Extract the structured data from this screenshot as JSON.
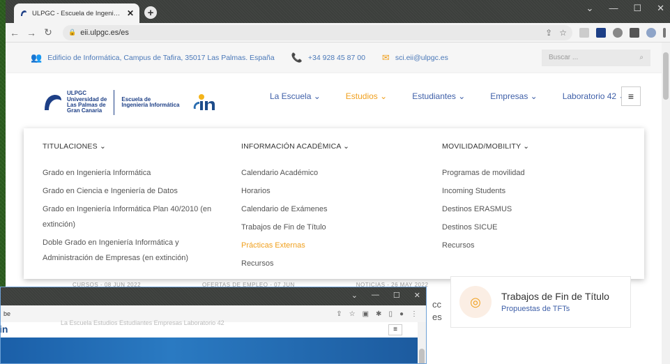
{
  "browser": {
    "tab_title": "ULPGC - Escuela de Ingeniería Inf...",
    "tab_close": "✕",
    "new_tab": "+",
    "url": "eii.ulpgc.es/es",
    "window_controls": [
      "⌄",
      "—",
      "☐",
      "✕"
    ]
  },
  "topinfo": {
    "address": "Edificio de Informática, Campus de Tafira, 35017 Las Palmas. España",
    "phone": "+34 928 45 87 00",
    "email": "sci.eii@ulpgc.es",
    "search_placeholder": "Buscar ..."
  },
  "logo": {
    "ulpgc_line1": "ULPGC",
    "ulpgc_line2": "Universidad de",
    "ulpgc_line3": "Las Palmas de",
    "ulpgc_line4": "Gran Canaria",
    "eii_line1": "Escuela de",
    "eii_line2": "Ingeniería Informática"
  },
  "nav": {
    "items": [
      {
        "label": "La Escuela ⌄"
      },
      {
        "label": "Estudios ⌄"
      },
      {
        "label": "Estudiantes ⌄"
      },
      {
        "label": "Empresas ⌄"
      },
      {
        "label": "Laboratorio 42 ⌄"
      }
    ],
    "menu_icon": "≡"
  },
  "megamenu": {
    "titulaciones": {
      "heading": "TITULACIONES ⌄",
      "links": [
        "Grado en Ingeniería Informática",
        "Grado en Ciencia e Ingeniería de Datos",
        "Grado en Ingeniería Informática Plan 40/2010 (en",
        "extinción)",
        "Doble Grado en Ingeniería Informática y",
        "Administración de Empresas (en extinción)"
      ]
    },
    "informacion": {
      "heading": "INFORMACIÓN ACADÉMICA ⌄",
      "links": [
        "Calendario Académico",
        "Horarios",
        "Calendario de Exámenes",
        "Trabajos de Fin de Título",
        "Prácticas Externas",
        "Recursos"
      ]
    },
    "movilidad": {
      "heading": "MOVILIDAD/MOBILITY ⌄",
      "links": [
        "Programas de movilidad",
        "Incoming Students",
        "Destinos ERASMUS",
        "Destinos SICUE",
        "Recursos"
      ]
    }
  },
  "news": {
    "items": [
      "CURSOS - 08 JUN 2022",
      "OFERTAS DE EMPLEO - 07 JUN",
      "NOTICIAS - 26 MAY 2022"
    ]
  },
  "tft_card": {
    "title": "Trabajos de Fin de Título",
    "link": "Propuestas de TFTs"
  },
  "cut_text": {
    "line1": "cc",
    "line2": "es"
  },
  "window2": {
    "url": "be",
    "controls": [
      "⌄",
      "—",
      "☐",
      "✕"
    ],
    "menu_icon": "≡",
    "logo": "in",
    "nav_ghost": "La Escuela    Estudios    Estudiantes    Empresas    Laboratorio 42"
  },
  "colors": {
    "accent_orange": "#f0a01e",
    "link_blue": "#3e5fa8",
    "brand_blue": "#1d3f86"
  }
}
